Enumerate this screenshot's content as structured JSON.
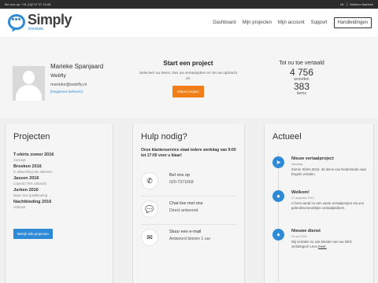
{
  "topbar": {
    "phone": "Bel ons op: +31 (0)2 07 37 16 68",
    "lang": "NL",
    "welcome": "Welkom Marieke"
  },
  "header": {
    "logo_name": "Simply",
    "logo_sub": "translate",
    "nav": [
      "Dashboard",
      "Mijn projecten",
      "Mijn account",
      "Support"
    ],
    "button": "Handleidingen"
  },
  "profile": {
    "name": "Marieke Spanjaard",
    "company": "Webfly",
    "email": "marieke@webfly.nl",
    "manage_link": "[Gegevens beheren]"
  },
  "start": {
    "title": "Start een project",
    "text": "Selecteer uw items, kies uw vertaalopties en zet uw opdracht uit.",
    "button": "Nieuw project"
  },
  "total": {
    "title": "Tot nu toe vertaald",
    "words": "4 756",
    "words_label": "woorden",
    "items": "383",
    "items_label": "items"
  },
  "projects": {
    "title": "Projecten",
    "list": [
      {
        "name": "T-shirts zomer 2016",
        "status": "Concept"
      },
      {
        "name": "Broeken 2016",
        "status": "In afwachting van akkoord"
      },
      {
        "name": "Jassen 2016",
        "status": "Lopend (75% voltooid)"
      },
      {
        "name": "Jurken 2016",
        "status": "Maar voor goedkeuring"
      },
      {
        "name": "Nachtkleding 2016",
        "status": "Voltooid"
      }
    ],
    "button": "Bekijk alle projecten"
  },
  "help": {
    "title": "Hulp nodig?",
    "intro": "Onze klantenservice staat iedere werkdag van 9:00 tot 17:00 voor u klaar!",
    "rows": [
      {
        "icon": "phone-icon",
        "glyph": "✆",
        "line1": "Bel ons op",
        "line2": "020-7371668"
      },
      {
        "icon": "chat-icon",
        "glyph": "💬",
        "line1": "Chat live met ons",
        "line2": "Direct antwoord"
      },
      {
        "icon": "envelope-icon",
        "glyph": "✉",
        "line1": "Stuur een e-mail",
        "line2": "Antwoord binnen 1 uur"
      }
    ]
  },
  "news": {
    "title": "Actueel",
    "items": [
      {
        "icon": "send-icon",
        "glyph": "➤",
        "title": "Nieuw vertaalproject",
        "date": "Vandaag",
        "body": "Zomer Shirts 2016. 45 items van Nederlands naar Engels vertalen."
      },
      {
        "icon": "user-icon",
        "glyph": "●",
        "title": "Welkom!",
        "date": "27 augustus 2016",
        "body": "U bent vanaf nu een vaste vertaalproject via ons gebruiksvriendelijke vertaalplatform."
      },
      {
        "icon": "bell-icon",
        "glyph": "♦",
        "title": "Nieuwe dienst",
        "date": "20 mei 2016",
        "body": "Wij vertalen nu ook teksten van uw SEO vertalingen! Lees",
        "link": "meer."
      }
    ]
  },
  "colors": {
    "accent": "#2d8ad6",
    "orange": "#f07f1a",
    "topbar": "#2c2c2c"
  }
}
